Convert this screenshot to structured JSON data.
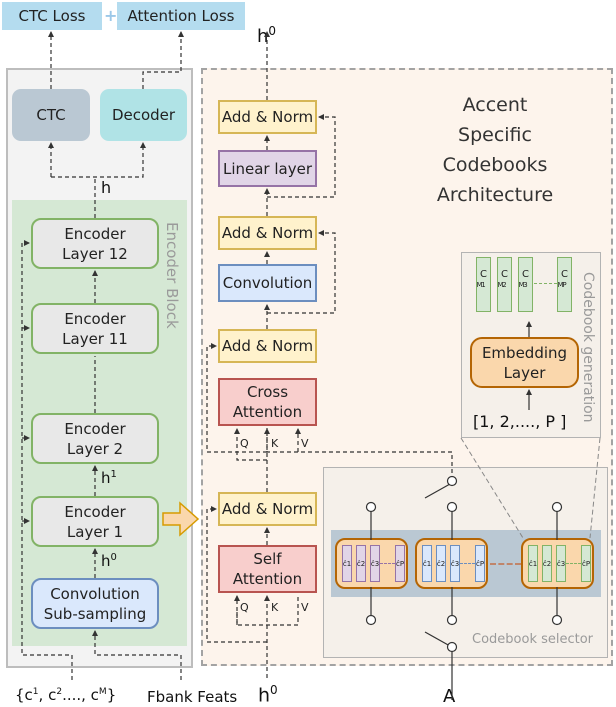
{
  "losses": {
    "ctc_loss": "CTC Loss",
    "plus": "+",
    "attention_loss": "Attention Loss"
  },
  "encoder": {
    "block_label": "Encoder Block",
    "ctc": "CTC",
    "decoder": "Decoder",
    "h_label": "h",
    "layers": [
      {
        "line1": "Encoder",
        "line2": "Layer 12"
      },
      {
        "line1": "Encoder",
        "line2": "Layer 11"
      },
      {
        "line1": "Encoder",
        "line2": "Layer 2"
      },
      {
        "line1": "Encoder",
        "line2": "Layer 1"
      }
    ],
    "h1_label": "h1",
    "h0_label": "h0",
    "conv_sub": {
      "line1": "Convolution",
      "line2": "Sub-sampling"
    }
  },
  "inputs": {
    "codebooks": "{c1, c2...., cM}",
    "fbank": "Fbank Feats",
    "h0": "h0",
    "accent": "A"
  },
  "accent_module": {
    "title": [
      "Accent",
      "Specific",
      "Codebooks",
      "Architecture"
    ],
    "output_label": "h0",
    "add_norm": "Add & Norm",
    "linear": "Linear layer",
    "convolution": "Convolution",
    "cross_attention": {
      "line1": "Cross",
      "line2": "Attention"
    },
    "self_attention": {
      "line1": "Self",
      "line2": "Attention"
    },
    "qkv": [
      "Q",
      "K",
      "V"
    ]
  },
  "codebook_generation": {
    "label": "Codebook generation",
    "codebooks": [
      "C1M",
      "C2M",
      "C3M",
      "CPM"
    ],
    "embedding": {
      "line1": "Embedding",
      "line2": "Layer"
    },
    "index_input": "[1, 2,...., P ]"
  },
  "codebook_selector": {
    "label": "Codebook selector",
    "groups": [
      {
        "color": "#e1d5e7",
        "border": "#9673a6",
        "entries": [
          "ĉ1",
          "ĉ2",
          "ĉ3",
          "ĉP"
        ]
      },
      {
        "color": "#dae8fc",
        "border": "#6c8ebf",
        "entries": [
          "ĉ1",
          "ĉ2",
          "ĉ3",
          "ĉP"
        ]
      },
      {
        "color": "#d5e8d4",
        "border": "#82b366",
        "entries": [
          "ĉ1",
          "ĉ2",
          "ĉ3",
          "ĉP"
        ]
      }
    ]
  }
}
